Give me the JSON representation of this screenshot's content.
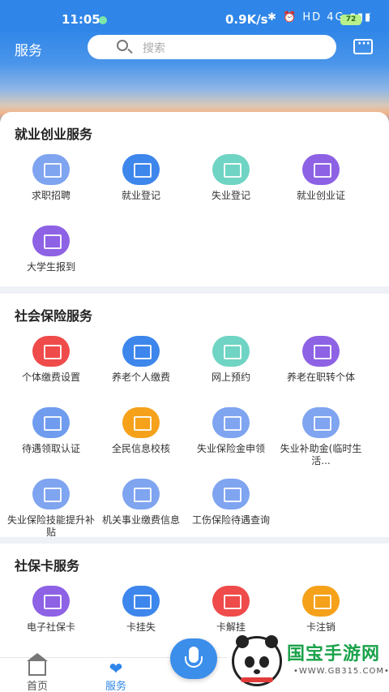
{
  "status": {
    "time": "11:05",
    "speed": "0.9K/s",
    "icons": "✱ ⏰ HD 4G ▮▮▮",
    "battery": "72"
  },
  "header": {
    "title": "服务",
    "search_placeholder": "搜索"
  },
  "sections": [
    {
      "title": "就业创业服务",
      "items": [
        {
          "label": "求职招聘",
          "color": "#7fa4f0"
        },
        {
          "label": "就业登记",
          "color": "#3d86ec"
        },
        {
          "label": "失业登记",
          "color": "#6fd4c4"
        },
        {
          "label": "就业创业证",
          "color": "#8d62e4"
        },
        {
          "label": "大学生报到",
          "color": "#8d62e4"
        }
      ]
    },
    {
      "title": "社会保险服务",
      "items": [
        {
          "label": "个体缴费设置",
          "color": "#ef4b4b"
        },
        {
          "label": "养老个人缴费",
          "color": "#3d86ec"
        },
        {
          "label": "网上预约",
          "color": "#6fd4c4"
        },
        {
          "label": "养老在职转个体",
          "color": "#8d62e4"
        },
        {
          "label": "待遇领取认证",
          "color": "#6f9cee"
        },
        {
          "label": "全民信息校核",
          "color": "#f5a11a"
        },
        {
          "label": "失业保险金申领",
          "color": "#7fa4f0"
        },
        {
          "label": "失业补助金(临时生活...",
          "color": "#7fa4f0"
        },
        {
          "label": "失业保险技能提升补贴",
          "color": "#7fa4f0"
        },
        {
          "label": "机关事业缴费信息",
          "color": "#7fa4f0"
        },
        {
          "label": "工伤保险待遇查询",
          "color": "#7fa4f0"
        }
      ]
    },
    {
      "title": "社保卡服务",
      "items": [
        {
          "label": "电子社保卡",
          "color": "#8d62e4"
        },
        {
          "label": "卡挂失",
          "color": "#3d86ec"
        },
        {
          "label": "卡解挂",
          "color": "#ef4b4b"
        },
        {
          "label": "卡注销",
          "color": "#f5a11a"
        }
      ]
    }
  ],
  "tabbar": {
    "home": "首页",
    "service": "服务"
  },
  "watermark": {
    "logo": "国宝手游网",
    "url": "•WWW.GB315.COM•"
  }
}
